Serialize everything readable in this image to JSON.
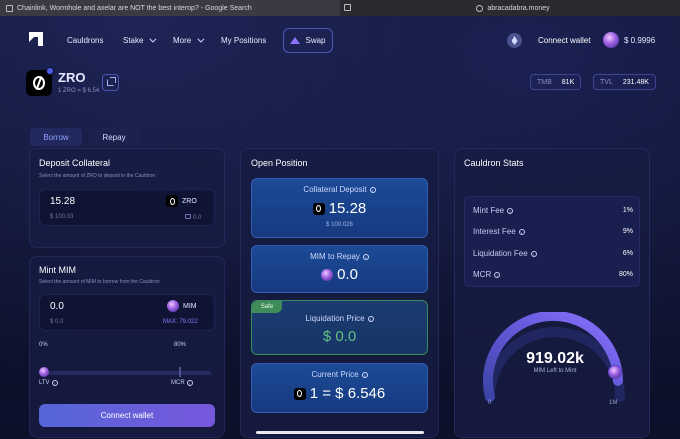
{
  "browser": {
    "tabs": [
      {
        "title": "Chainlink, Wormhole and axelar are NOT the best interop? - Google Search"
      },
      {
        "title": "abracadabra.money"
      }
    ]
  },
  "header": {
    "nav": [
      "Cauldrons",
      "Stake",
      "More",
      "My Positions"
    ],
    "swap_label": "Swap",
    "connect_label": "Connect wallet",
    "mim_price": "$ 0.9996"
  },
  "token": {
    "name": "ZRO",
    "rate": "1 ZRO = $ 6.54",
    "tmb_label": "TMB",
    "tmb_value": "81K",
    "tvl_label": "TVL",
    "tvl_value": "231.48K"
  },
  "tabs": {
    "borrow": "Borrow",
    "repay": "Repay"
  },
  "deposit": {
    "title": "Deposit Collateral",
    "subtitle": "Select the amount of ZRO to deposit in the Cauldron",
    "value": "15.28",
    "usd": "$ 100.03",
    "token": "ZRO",
    "balance": "0.0"
  },
  "mint": {
    "title": "Mint MIM",
    "subtitle": "Select the amount of MIM to borrow from the Cauldron",
    "value": "0.0",
    "usd": "$ 0.0",
    "token": "MIM",
    "max": "MAX: 79.022",
    "ltv_min": "0%",
    "ltv_mark": "80%",
    "ltv_label": "LTV",
    "mcr_label": "MCR",
    "ltv_fraction": 0.0
  },
  "connect_button": "Connect wallet",
  "position": {
    "title": "Open Position",
    "collateral_label": "Collateral Deposit",
    "collateral_value": "15.28",
    "collateral_usd": "$ 100.028",
    "mim_label": "MIM to Repay",
    "mim_value": "0.0",
    "safe_badge": "Safe",
    "liq_label": "Liquidation Price",
    "liq_value": "$ 0.0",
    "price_label": "Current Price",
    "price_value": "1 = $ 6.546"
  },
  "stats": {
    "title": "Cauldron Stats",
    "rows": [
      {
        "label": "Mint Fee",
        "value": "1%"
      },
      {
        "label": "Interest Fee",
        "value": "9%"
      },
      {
        "label": "Liquidation Fee",
        "value": "6%"
      },
      {
        "label": "MCR",
        "value": "80%"
      }
    ],
    "gauge_value": "919.02k",
    "gauge_sub": "MIM Left to Mint",
    "gauge_min": "0",
    "gauge_max": "1M",
    "gauge_fraction": 0.92
  }
}
